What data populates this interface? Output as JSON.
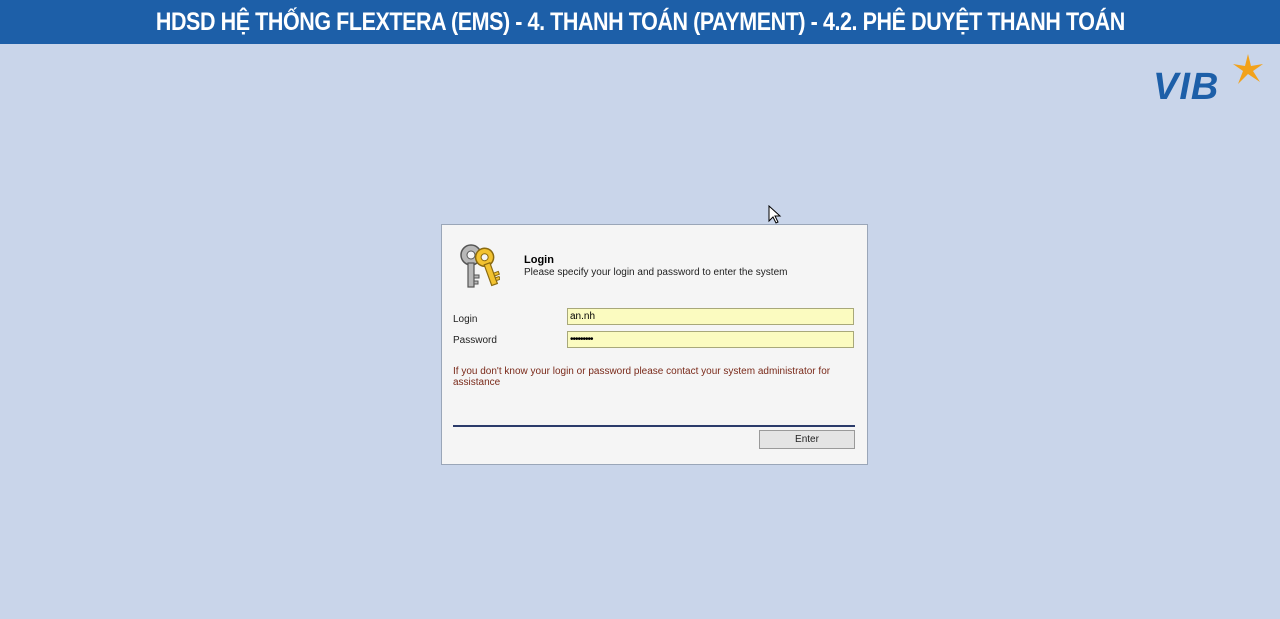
{
  "banner": {
    "title": "HDSD HỆ THỐNG FLEXTERA (EMS) - 4. THANH TOÁN (PAYMENT) - 4.2. PHÊ DUYỆT THANH TOÁN"
  },
  "logo": {
    "text": "VIB",
    "color": "#1d5fa8",
    "accent_color": "#f2a21b"
  },
  "dialog": {
    "icon": "keys-icon",
    "title": "Login",
    "subtitle": "Please specify your login and password to enter the system",
    "login_label": "Login",
    "login_value": "an.nh",
    "password_label": "Password",
    "password_value": "•••••••••",
    "help_text": "If you don't know your login or password please contact your system administrator for assistance",
    "enter_label": "Enter"
  },
  "colors": {
    "banner_bg": "#1d5fa8",
    "page_bg": "#c9d5ea",
    "field_bg": "#fbfbc0"
  }
}
